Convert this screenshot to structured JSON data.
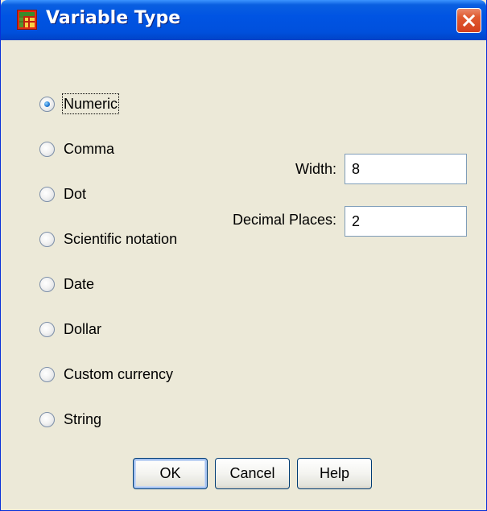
{
  "window": {
    "title": "Variable Type",
    "app_icon": "spss-grid-icon",
    "close_icon": "close-icon"
  },
  "types": [
    {
      "label": "Numeric",
      "checked": true
    },
    {
      "label": "Comma",
      "checked": false
    },
    {
      "label": "Dot",
      "checked": false
    },
    {
      "label": "Scientific notation",
      "checked": false
    },
    {
      "label": "Date",
      "checked": false
    },
    {
      "label": "Dollar",
      "checked": false
    },
    {
      "label": "Custom currency",
      "checked": false
    },
    {
      "label": "String",
      "checked": false
    }
  ],
  "fields": {
    "width_label": "Width:",
    "width_value": "8",
    "decimals_label": "Decimal Places:",
    "decimals_value": "2"
  },
  "buttons": {
    "ok": "OK",
    "cancel": "Cancel",
    "help": "Help"
  },
  "colors": {
    "title_bar": "#0054e3",
    "close_button": "#e05a30",
    "dialog_bg": "#ece9d8"
  }
}
